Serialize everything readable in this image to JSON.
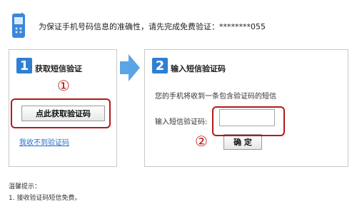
{
  "header": {
    "phone_icon": "mobile-phone-icon",
    "message": "为保证手机号码信息的准确性，请先完成免费验证：********055"
  },
  "step1": {
    "number": "1",
    "title": "获取短信验证",
    "get_code_button": "点此获取验证码",
    "link_no_sms": "我收不到验证码",
    "marker": "①"
  },
  "step2": {
    "number": "2",
    "title": "输入短信验证码",
    "description": "您的手机将收到一条包含验证码的短信",
    "code_label": "输入短信验证码:",
    "code_value": "",
    "confirm_button": "确 定",
    "marker": "②"
  },
  "tips": {
    "title": "温馨提示：",
    "items": [
      "1. 接收验证码短信免费。"
    ]
  },
  "colors": {
    "step_badge": "#2f7fd3",
    "arrow": "#5aa5e6",
    "highlight": "#b21a1a",
    "link": "#2a6ec6"
  }
}
